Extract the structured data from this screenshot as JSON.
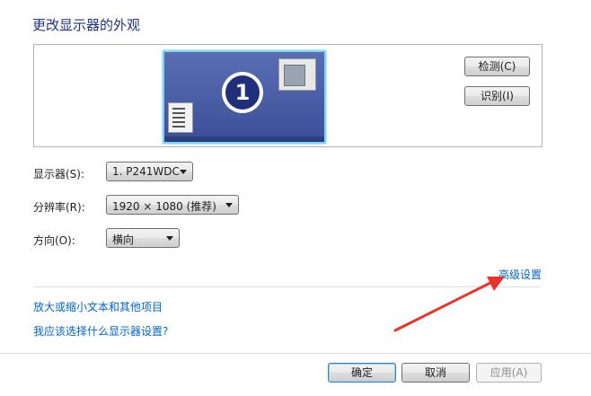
{
  "page": {
    "title": "更改显示器的外观"
  },
  "preview": {
    "monitor_number": "1"
  },
  "buttons": {
    "detect": "检测(C)",
    "identify": "识别(I)",
    "ok": "确定",
    "cancel": "取消",
    "apply": "应用(A)"
  },
  "fields": {
    "display": {
      "label": "显示器(S):",
      "value": "1. P241WDC"
    },
    "resolution": {
      "label": "分辨率(R):",
      "value": "1920 × 1080 (推荐)"
    },
    "orientation": {
      "label": "方向(O):",
      "value": "横向"
    }
  },
  "links": {
    "advanced": "高级设置",
    "text_size": "放大或缩小文本和其他项目",
    "help": "我应该选择什么显示器设置?"
  },
  "annotation": {
    "arrow_color": "#e8342a"
  }
}
